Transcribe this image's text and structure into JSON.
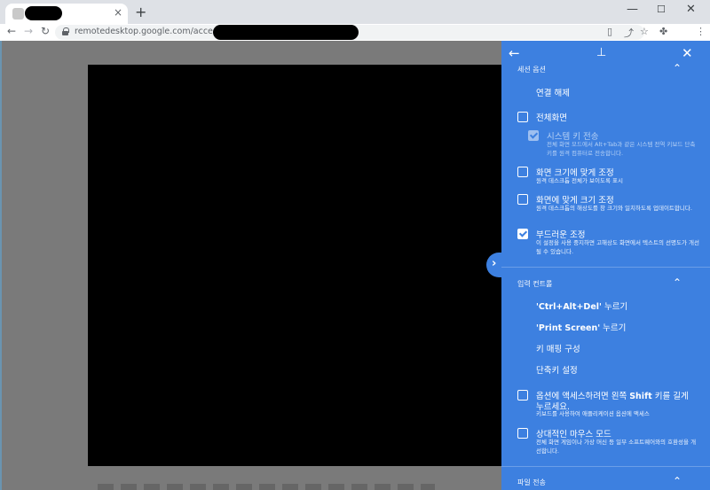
{
  "browser": {
    "new_tab": "+",
    "tab_close": "×",
    "win_min": "—",
    "win_max": "☐",
    "win_close": "✕",
    "back": "←",
    "forward": "→",
    "reload": "↻",
    "url": "remotedesktop.google.com/access/session"
  },
  "panel": {
    "session_options_title": "세션 옵션",
    "disconnect": "연결 해제",
    "fullscreen": "전체화면",
    "send_system_keys": "시스템 키 전송",
    "send_system_keys_desc": "전체 화면 모드에서 Alt+Tab과 같은 시스템 전역 키보드 단축키를 원격 컴퓨터로 전송합니다.",
    "scale_to_fit": "화면 크기에 맞게 조정",
    "scale_to_fit_desc": "원격 데스크톱 전체가 보이도록 표시",
    "resize_to_fit": "화면에 맞게 크기 조정",
    "resize_to_fit_desc": "원격 데스크톱의 해상도를 창 크기와 일치하도록 업데이트합니다.",
    "smooth_scaling": "부드러운 조정",
    "smooth_scaling_desc": "이 설정을 사용 중지하면 고해상도 화면에서 텍스트의 선명도가 개선될 수 있습니다.",
    "input_controls_title": "입력 컨트롤",
    "ctrl_alt_del_bold": "'Ctrl+Alt+Del'",
    "ctrl_alt_del_rest": " 누르기",
    "print_screen_bold": "'Print Screen'",
    "print_screen_rest": " 누르기",
    "key_mapping": "키 매핑 구성",
    "shortcuts": "단축키 설정",
    "shift_access_1": "옵션에 액세스하려면 왼쪽 ",
    "shift_access_bold": "Shift",
    "shift_access_2": " 키를 길게",
    "shift_access_3": "누르세요.",
    "shift_access_desc": "키보드를 사용하여 애플리케이션 옵션에 액세스",
    "relative_mouse": "상대적인 마우스 모드",
    "relative_mouse_desc": "전체 화면 게임이나 가상 머신 등 일부 소프트웨어와의 호환성을 개선합니다.",
    "file_transfer_title": "파일 전송"
  },
  "colors": {
    "panel_bg": "#3d80e0",
    "remote_bg": "#000000",
    "content_bg": "#7a7a7a"
  }
}
